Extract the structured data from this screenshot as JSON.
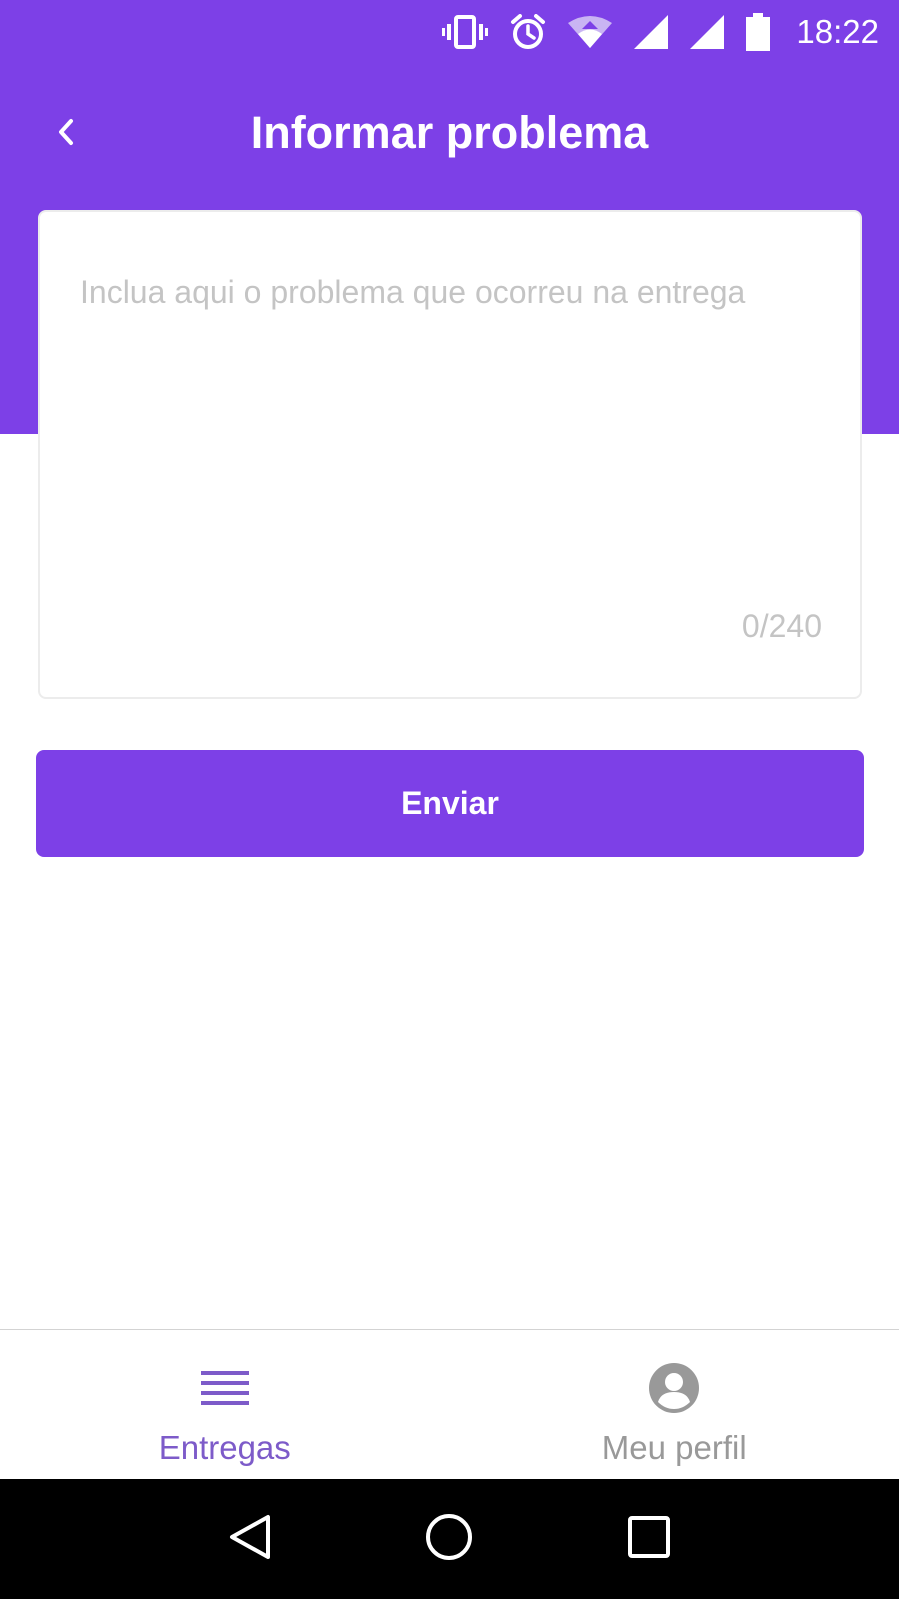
{
  "status_bar": {
    "time": "18:22",
    "icons": [
      "vibrate-icon",
      "alarm-icon",
      "wifi-icon",
      "signal-icon",
      "signal-icon",
      "battery-icon"
    ]
  },
  "header": {
    "title": "Informar problema",
    "back_icon": "chevron-left-icon"
  },
  "form": {
    "placeholder": "Inclua aqui o problema que ocorreu na entrega",
    "value": "",
    "counter": "0/240",
    "submit_label": "Enviar"
  },
  "tabbar": {
    "tabs": [
      {
        "label": "Entregas",
        "icon": "list-icon",
        "active": true
      },
      {
        "label": "Meu perfil",
        "icon": "account-circle-icon",
        "active": false
      }
    ]
  },
  "colors": {
    "primary": "#7d40e7",
    "tab_active": "#7d5bc9",
    "tab_inactive": "#999999",
    "placeholder": "#c4c4c4"
  },
  "nav_bar": {
    "buttons": [
      "back-triangle-icon",
      "home-circle-icon",
      "recents-square-icon"
    ]
  }
}
